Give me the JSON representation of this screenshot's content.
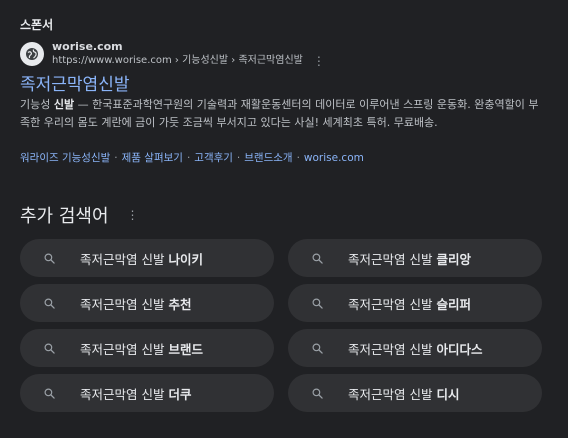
{
  "sponsor_label": "스폰서",
  "site": {
    "name": "worise.com",
    "url": "https://www.worise.com › 기능성신발 › 족저근막염신발"
  },
  "ad": {
    "title": "족저근막염신발",
    "description_lead": "기능성 ",
    "description_bold": "신발",
    "description_rest": " — 한국표준과학연구원의 기술력과 재활운동센터의 데이터로 이루어낸 스프링 운동화. 완충역할이 부족한 우리의 몸도 계란에 금이 가듯 조금씩 부서지고 있다는 사실! 세계최초 특허. 무료배송.",
    "sitelinks": [
      "워라이즈 기능성신발",
      "제품 살펴보기",
      "고객후기",
      "브랜드소개",
      "worise.com"
    ]
  },
  "more_searches": {
    "title": "추가 검색어",
    "items": [
      {
        "prefix": "족저근막염 신발 ",
        "bold": "나이키"
      },
      {
        "prefix": "족저근막염 신발 ",
        "bold": "클리앙"
      },
      {
        "prefix": "족저근막염 신발 ",
        "bold": "추천"
      },
      {
        "prefix": "족저근막염 신발 ",
        "bold": "슬리퍼"
      },
      {
        "prefix": "족저근막염 신발 ",
        "bold": "브랜드"
      },
      {
        "prefix": "족저근막염 신발 ",
        "bold": "아디다스"
      },
      {
        "prefix": "족저근막염 신발 ",
        "bold": "더쿠"
      },
      {
        "prefix": "족저근막염 신발 ",
        "bold": "디시"
      }
    ]
  },
  "icons": {
    "favicon": "globe-icon",
    "more": "more-vert-icon",
    "search": "search-icon"
  },
  "colors": {
    "background": "#202124",
    "link": "#8ab4f8",
    "chip": "#303134"
  }
}
